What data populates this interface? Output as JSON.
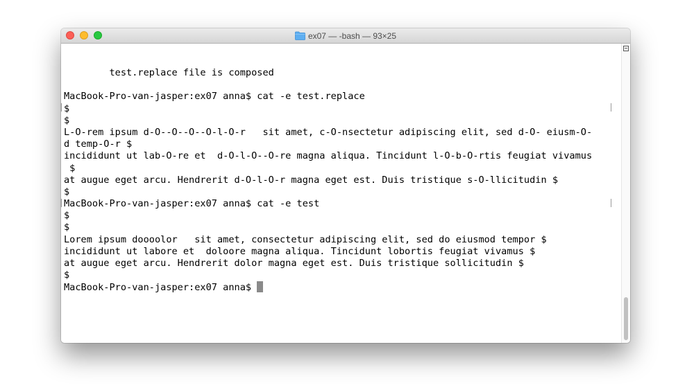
{
  "window": {
    "title": "ex07 — -bash — 93×25",
    "folder_icon": "folder-icon"
  },
  "terminal": {
    "lines": [
      "        test.replace file is composed",
      "",
      "MacBook-Pro-van-jasper:ex07 anna$ cat -e test.replace",
      "$",
      "$",
      "L-O-rem ipsum d-O--O--O--O-l-O-r   sit amet, c-O-nsectetur adipiscing elit, sed d-O- eiusm-O-",
      "d temp-O-r $",
      "incididunt ut lab-O-re et  d-O-l-O--O-re magna aliqua. Tincidunt l-O-b-O-rtis feugiat vivamus",
      " $",
      "at augue eget arcu. Hendrerit d-O-l-O-r magna eget est. Duis tristique s-O-llicitudin $",
      "$",
      "MacBook-Pro-van-jasper:ex07 anna$ cat -e test",
      "$",
      "$",
      "Lorem ipsum doooolor   sit amet, consectetur adipiscing elit, sed do eiusmod tempor $",
      "incididunt ut labore et  doloore magna aliqua. Tincidunt lobortis feugiat vivamus $",
      "at augue eget arcu. Hendrerit dolor magna eget est. Duis tristique sollicitudin $",
      "$"
    ],
    "current_prompt": "MacBook-Pro-van-jasper:ex07 anna$ "
  },
  "colors": {
    "close": "#fc5f57",
    "minimize": "#fdbc2e",
    "zoom": "#28c840",
    "cursor": "#8a8a8a"
  }
}
